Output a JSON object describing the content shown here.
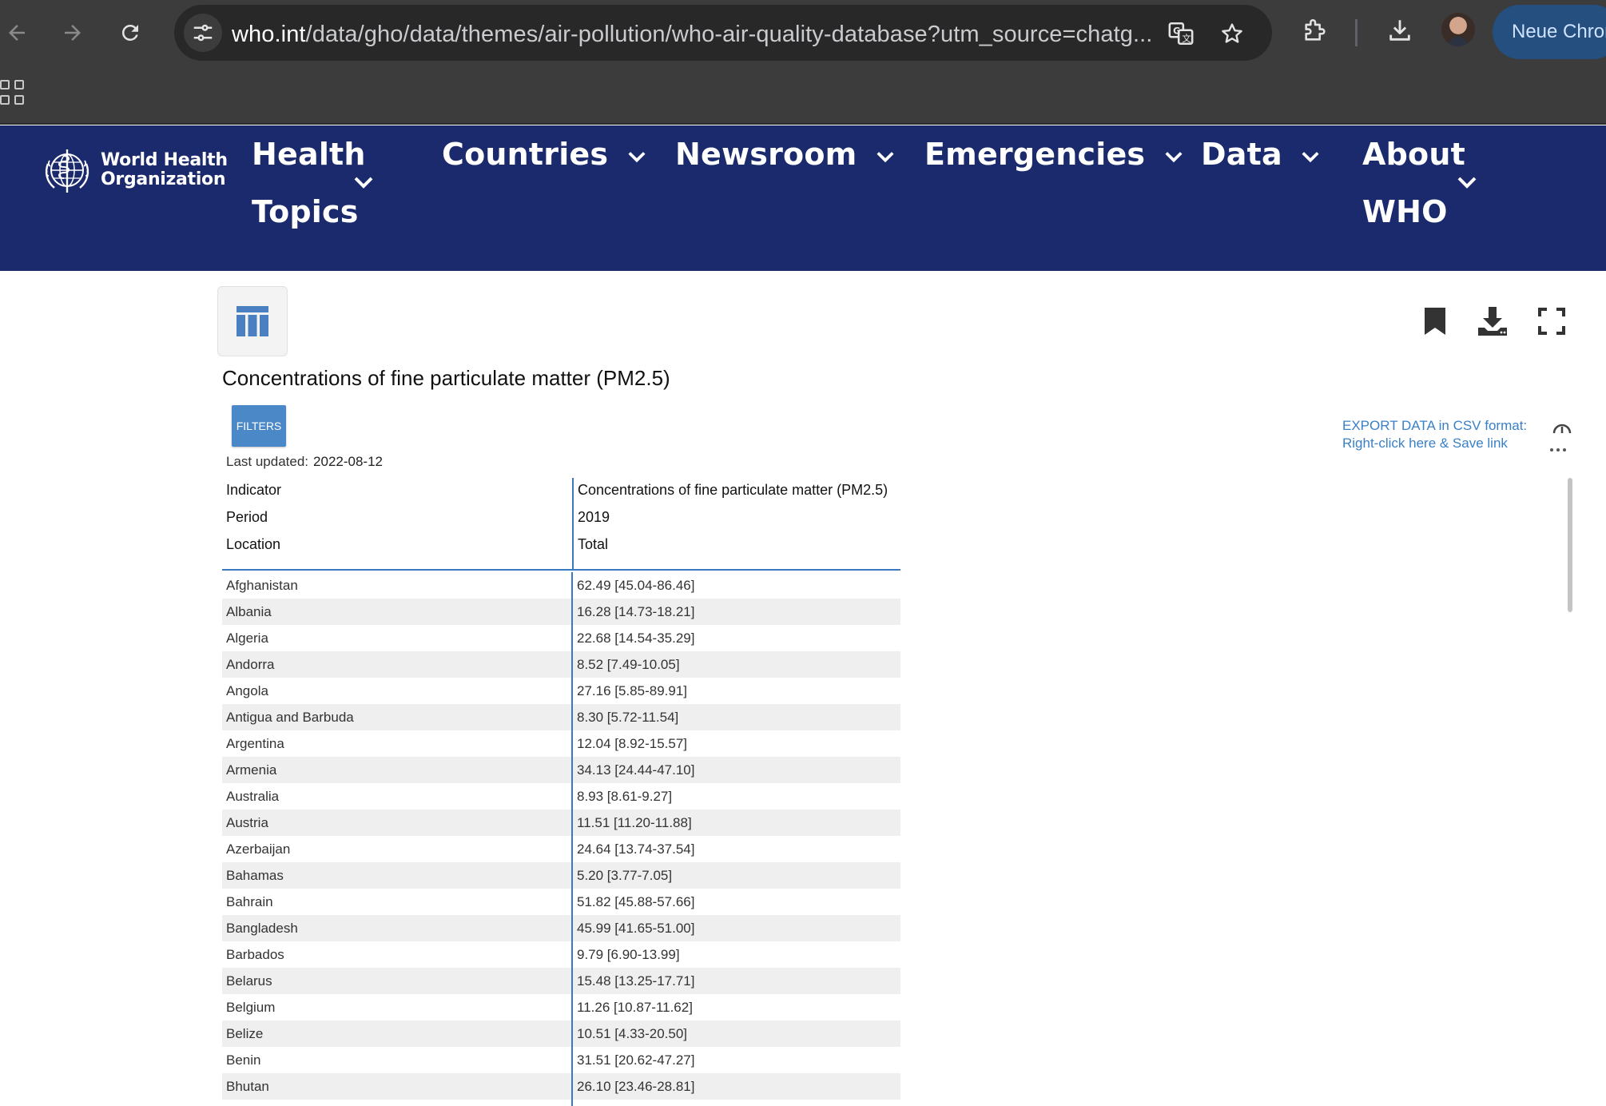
{
  "browser": {
    "url_host": "who.int",
    "url_path": "/data/gho/data/themes/air-pollution/who-air-quality-database?utm_source=chatg...",
    "profile_label": "Neue Chrom"
  },
  "site": {
    "logo_line1": "World Health",
    "logo_line2": "Organization",
    "nav": [
      {
        "line1": "Health",
        "line2": "Topics"
      },
      {
        "line1": "Countries"
      },
      {
        "line1": "Newsroom"
      },
      {
        "line1": "Emergencies"
      },
      {
        "line1": "Data"
      },
      {
        "line1": "About",
        "line2": "WHO"
      }
    ]
  },
  "content": {
    "title": "Concentrations of fine particulate matter (PM2.5)",
    "filters_label": "FILTERS",
    "last_updated_label": "Last updated:",
    "last_updated_value": "2022-08-12",
    "export_line1": "EXPORT DATA in CSV format:",
    "export_line2": "Right-click here & Save link"
  },
  "table": {
    "header_labels": [
      "Indicator",
      "Period",
      "Location"
    ],
    "header_values": [
      "Concentrations of fine particulate matter (PM2.5)",
      "2019",
      "Total"
    ],
    "rows": [
      {
        "country": "Afghanistan",
        "value": "62.49 [45.04-86.46]"
      },
      {
        "country": "Albania",
        "value": "16.28 [14.73-18.21]"
      },
      {
        "country": "Algeria",
        "value": "22.68 [14.54-35.29]"
      },
      {
        "country": "Andorra",
        "value": "8.52 [7.49-10.05]"
      },
      {
        "country": "Angola",
        "value": "27.16 [5.85-89.91]"
      },
      {
        "country": "Antigua and Barbuda",
        "value": "8.30 [5.72-11.54]"
      },
      {
        "country": "Argentina",
        "value": "12.04 [8.92-15.57]"
      },
      {
        "country": "Armenia",
        "value": "34.13 [24.44-47.10]"
      },
      {
        "country": "Australia",
        "value": "8.93 [8.61-9.27]"
      },
      {
        "country": "Austria",
        "value": "11.51 [11.20-11.88]"
      },
      {
        "country": "Azerbaijan",
        "value": "24.64 [13.74-37.54]"
      },
      {
        "country": "Bahamas",
        "value": "5.20 [3.77-7.05]"
      },
      {
        "country": "Bahrain",
        "value": "51.82 [45.88-57.66]"
      },
      {
        "country": "Bangladesh",
        "value": "45.99 [41.65-51.00]"
      },
      {
        "country": "Barbados",
        "value": "9.79 [6.90-13.99]"
      },
      {
        "country": "Belarus",
        "value": "15.48 [13.25-17.71]"
      },
      {
        "country": "Belgium",
        "value": "11.26 [10.87-11.62]"
      },
      {
        "country": "Belize",
        "value": "10.51 [4.33-20.50]"
      },
      {
        "country": "Benin",
        "value": "31.51 [20.62-47.27]"
      },
      {
        "country": "Bhutan",
        "value": "26.10 [23.46-28.81]"
      }
    ]
  },
  "icons": {
    "back": "arrow-left-icon",
    "forward": "arrow-right-icon",
    "reload": "reload-icon",
    "site_settings": "tune-icon",
    "translate": "translate-icon",
    "bookmark_star": "star-icon",
    "extensions": "puzzle-icon",
    "downloads": "download-icon",
    "apps": "apps-grid-icon",
    "table_view": "table-icon",
    "bookmark": "bookmark-icon",
    "download_data": "download-icon",
    "fullscreen": "fullscreen-icon"
  },
  "colors": {
    "who_navy": "#1a2a6c",
    "accent_blue": "#4a88c8",
    "link_blue": "#3a80c7",
    "divider_blue": "#3a78c0",
    "row_alt": "#efefef",
    "chrome_dark": "#3c3c3c"
  }
}
